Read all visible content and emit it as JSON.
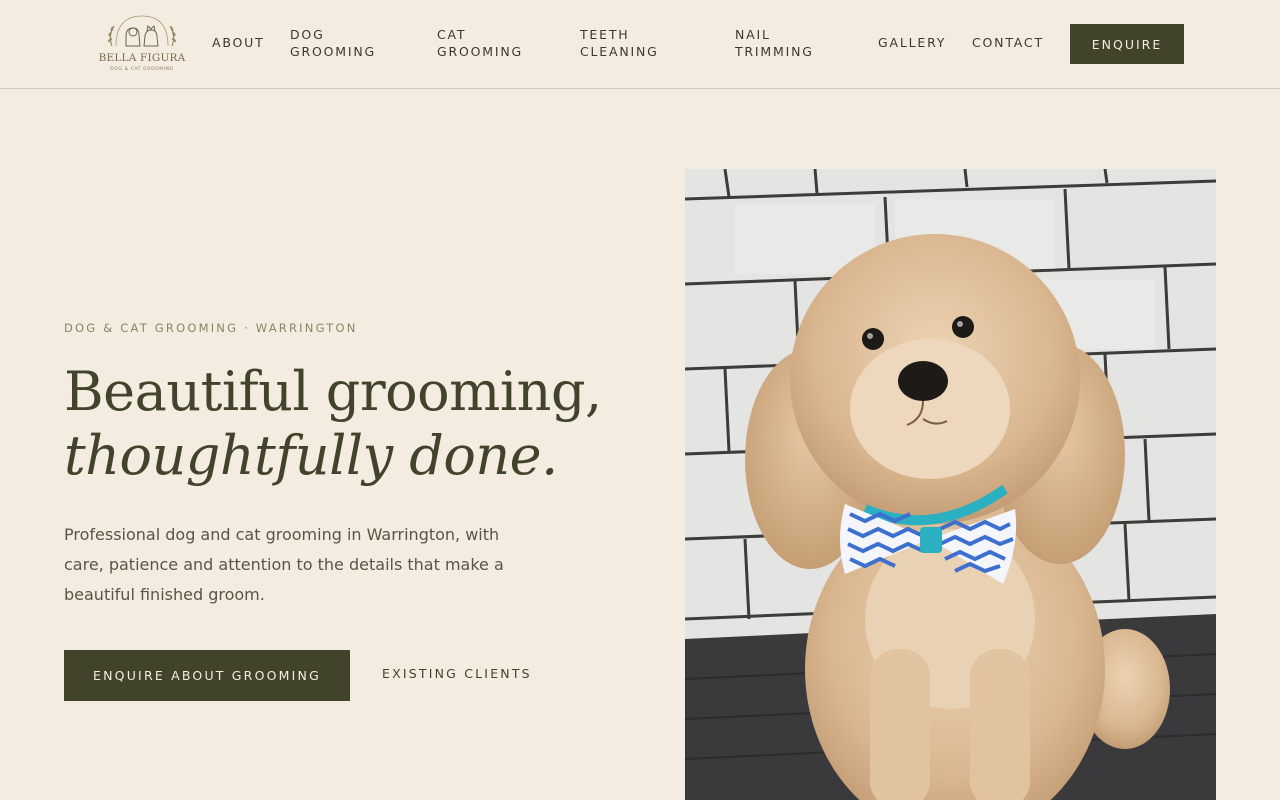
{
  "brand": {
    "name": "BELLA FIGURA",
    "tagline": "DOG & CAT GROOMING"
  },
  "nav": {
    "items": [
      {
        "label": "ABOUT"
      },
      {
        "label": "DOG GROOMING"
      },
      {
        "label": "CAT GROOMING"
      },
      {
        "label": "TEETH CLEANING"
      },
      {
        "label": "NAIL TRIMMING"
      },
      {
        "label": "GALLERY"
      },
      {
        "label": "CONTACT"
      }
    ],
    "cta_label": "ENQUIRE"
  },
  "hero": {
    "eyebrow": "DOG & CAT GROOMING · WARRINGTON",
    "title_line1": "Beautiful grooming,",
    "title_line2": "thoughtfully done.",
    "body": "Professional dog and cat grooming in Warrington, with care, patience and attention to the details that make a beautiful finished groom.",
    "primary_cta": "ENQUIRE ABOUT GROOMING",
    "secondary_cta": "EXISTING CLIENTS"
  },
  "colors": {
    "background": "#f4ece0",
    "accent": "#41442b",
    "muted_text": "#8c8463",
    "divider": "#d6cdbf"
  }
}
